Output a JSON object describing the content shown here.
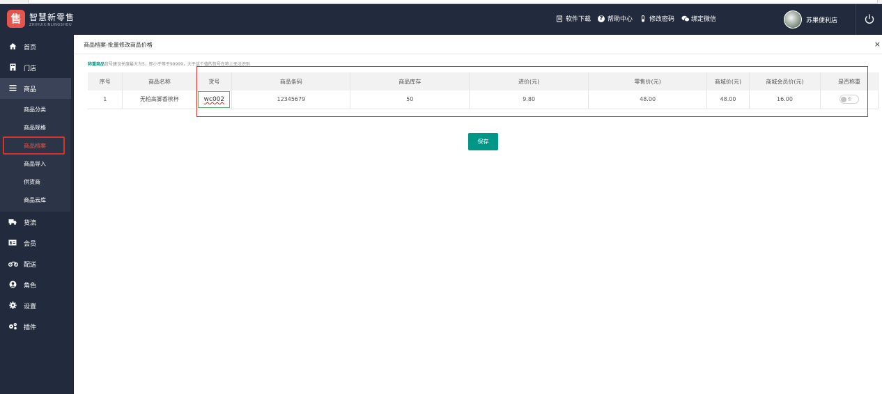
{
  "header": {
    "logo_title": "智慧新零售",
    "logo_sub": "ZHIHUIXINLINGSHOU",
    "links": [
      {
        "icon": "download-icon",
        "label": "软件下载"
      },
      {
        "icon": "help-icon",
        "label": "帮助中心"
      },
      {
        "icon": "password-icon",
        "label": "修改密码"
      },
      {
        "icon": "wechat-icon",
        "label": "绑定微信"
      }
    ],
    "username": "苏果便利店"
  },
  "sidebar": {
    "items": [
      {
        "icon": "home-icon",
        "label": "首页"
      },
      {
        "icon": "store-icon",
        "label": "门店"
      },
      {
        "icon": "list-icon",
        "label": "商品"
      },
      {
        "icon": "truck-icon",
        "label": "货流"
      },
      {
        "icon": "member-card-icon",
        "label": "会员"
      },
      {
        "icon": "motorcycle-icon",
        "label": "配送"
      },
      {
        "icon": "user-circle-icon",
        "label": "角色"
      },
      {
        "icon": "gear-icon",
        "label": "设置"
      },
      {
        "icon": "plugin-icon",
        "label": "插件"
      }
    ],
    "submenu": [
      "商品分类",
      "商品规格",
      "商品档案",
      "商品导入",
      "供货商",
      "商品云库"
    ],
    "current_sub": "商品档案"
  },
  "page": {
    "tab_title": "商品档案-批量修改商品价格",
    "close_glyph": "×",
    "notice_bold": "称重商品",
    "notice_text": "货号建议长度最大为5，即小于等于99999，大于这个值的货号在称上无法识别",
    "save_label": "保存"
  },
  "table": {
    "headers": [
      "序号",
      "商品名称",
      "货号",
      "商品条码",
      "商品库存",
      "进价(元)",
      "零售价(元)",
      "商城价(元)",
      "商城会员价(元)",
      "是否称重"
    ],
    "rows": [
      {
        "no": "1",
        "name": "无柏高脚香槟杯",
        "code": "wc002",
        "barcode": "12345679",
        "stock": "50",
        "cost": "9.80",
        "retail": "48.00",
        "mall": "48.00",
        "member": "16.00",
        "weigh": "否"
      }
    ]
  },
  "colors": {
    "header_bg": "#222b3d",
    "accent": "#009688",
    "highlight": "#e02d2d"
  }
}
